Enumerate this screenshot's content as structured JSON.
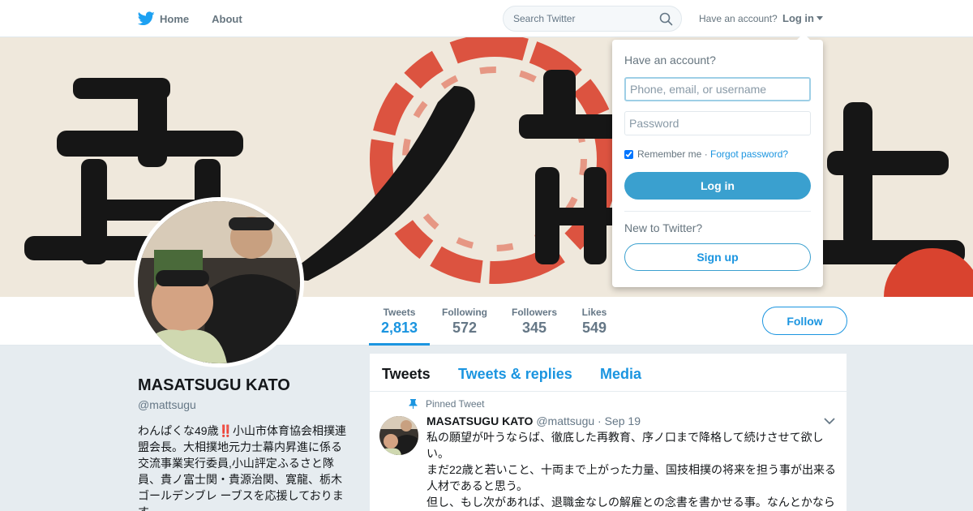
{
  "colors": {
    "accent": "#1b95e0",
    "button_fill": "#3aa0cf",
    "background": "#e6ecf0"
  },
  "nav": {
    "home_label": "Home",
    "about_label": "About",
    "search_placeholder": "Search Twitter",
    "have_account": "Have an account?",
    "login_label": "Log in"
  },
  "banner": {
    "description_icon": "calligraphy-banner-image"
  },
  "stats": [
    {
      "label": "Tweets",
      "value": "2,813"
    },
    {
      "label": "Following",
      "value": "572"
    },
    {
      "label": "Followers",
      "value": "345"
    },
    {
      "label": "Likes",
      "value": "549"
    }
  ],
  "follow_label": "Follow",
  "profile": {
    "name": "MASATSUGU KATO",
    "handle": "@mattsugu",
    "bio": "わんぱくな49歳‼️小山市体育協会相撲連盟会長。大相撲地元力士幕内昇進に係る交流事業実行委員,小山評定ふるさと隊員、貴ノ富士関・貴源治関、寛龍、栃木ゴールデンブレ ーブスを応援しておりま す。"
  },
  "timeline": {
    "tabs": [
      "Tweets",
      "Tweets & replies",
      "Media"
    ],
    "pinned_label": "Pinned Tweet",
    "tweet": {
      "name": "MASATSUGU KATO",
      "handle": "@mattsugu",
      "date": "Sep 19",
      "text": "私の願望が叶うならば、徹底した再教育、序ノ口まで降格して続けさせて欲しい。\nまだ22歳と若いこと、十両まで上がった力量、国技相撲の将来を担う事が出来る人材であると思う。\n但し、もし次があれば、退職金なしの解雇との念書を書かせる事。なんとかなら"
    }
  },
  "login_dropdown": {
    "title": "Have an account?",
    "username_placeholder": "Phone, email, or username",
    "password_placeholder": "Password",
    "remember_label": "Remember me",
    "separator": " · ",
    "forgot_label": "Forgot password?",
    "login_button": "Log in",
    "new_label": "New to Twitter?",
    "signup_button": "Sign up"
  }
}
